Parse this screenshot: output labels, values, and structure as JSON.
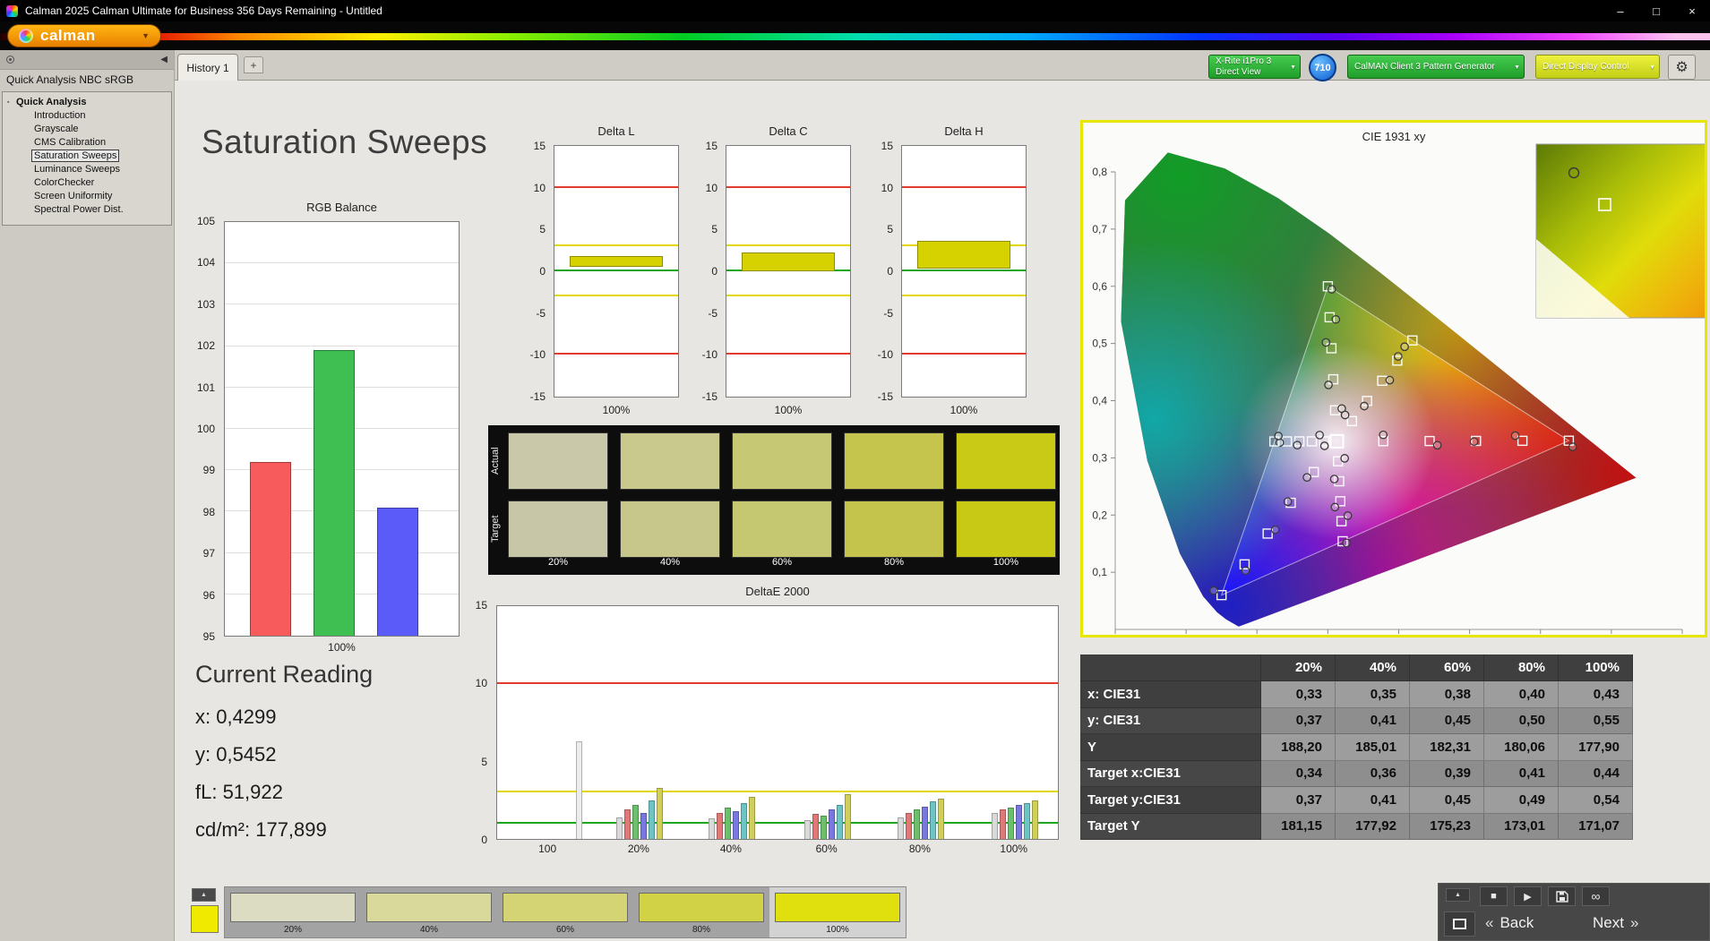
{
  "window": {
    "title": "Calman 2025 Calman Ultimate for Business 356 Days Remaining  - Untitled"
  },
  "icons": {
    "minimize": "–",
    "maximize": "□",
    "close": "×",
    "caret_down": "▼",
    "collapse_left": "◀",
    "up": "▲",
    "stop": "■",
    "play": "▶",
    "infinity": "∞",
    "gear": "⚙",
    "back_arrows": "«",
    "next_arrows": "»",
    "tree_bullet": "▪"
  },
  "toolbar": {
    "logo": "calman"
  },
  "tab_bar": {
    "tabs": [
      {
        "label": "History 1",
        "active": true
      }
    ],
    "add_label": "+",
    "meter_button": {
      "line1": "X-Rite i1Pro 3",
      "line2": "Direct View",
      "color": "#1f9e2a"
    },
    "meter_badge": "710",
    "source_button": {
      "line1": "CalMAN Client 3 Pattern Generator",
      "color": "#1f9e2a"
    },
    "display_button": {
      "line1": "Direct Display Control",
      "color": "#d8e02a"
    }
  },
  "sidebar": {
    "workflow_title": "Quick Analysis NBC sRGB",
    "root_item": "Quick Analysis",
    "items": [
      {
        "label": "Introduction",
        "selected": false
      },
      {
        "label": "Grayscale",
        "selected": false
      },
      {
        "label": "CMS Calibration",
        "selected": false
      },
      {
        "label": "Saturation Sweeps",
        "selected": true
      },
      {
        "label": "Luminance Sweeps",
        "selected": false
      },
      {
        "label": "ColorChecker",
        "selected": false
      },
      {
        "label": "Screen Uniformity",
        "selected": false
      },
      {
        "label": "Spectral Power Dist.",
        "selected": false
      }
    ]
  },
  "page_title": "Saturation Sweeps",
  "current_reading": {
    "title": "Current Reading",
    "x": "x: 0,4299",
    "y": "y: 0,5452",
    "fl": "fL: 51,922",
    "cdm2": "cd/m²: 177,899"
  },
  "chart_data": [
    {
      "id": "rgb_balance",
      "type": "bar",
      "title": "RGB Balance",
      "categories": [
        "Red",
        "Green",
        "Blue"
      ],
      "values": [
        99.2,
        101.9,
        98.1
      ],
      "colors": [
        "#f85b5b",
        "#3fbf51",
        "#5b5bf9"
      ],
      "ylim": [
        95,
        105
      ],
      "xlabel": "100%",
      "grid": true
    },
    {
      "id": "delta_l",
      "type": "bar",
      "title": "Delta L",
      "bar_from": 0.5,
      "bar_to": 1.8,
      "xlabel": "100%",
      "ylim": [
        -15,
        15
      ],
      "yticks": [
        -15,
        -10,
        -5,
        0,
        5,
        10,
        15
      ],
      "limit_lines": {
        "red": [
          10,
          -10
        ],
        "yellow": [
          3,
          -3
        ],
        "green": [
          0
        ]
      }
    },
    {
      "id": "delta_c",
      "type": "bar",
      "title": "Delta C",
      "bar_from": 0.0,
      "bar_to": 2.2,
      "xlabel": "100%",
      "ylim": [
        -15,
        15
      ],
      "yticks": [
        -15,
        -10,
        -5,
        0,
        5,
        10,
        15
      ],
      "limit_lines": {
        "red": [
          10,
          -10
        ],
        "yellow": [
          3,
          -3
        ],
        "green": [
          0
        ]
      }
    },
    {
      "id": "delta_h",
      "type": "bar",
      "title": "Delta H",
      "bar_from": 0.3,
      "bar_to": 3.6,
      "xlabel": "100%",
      "ylim": [
        -15,
        15
      ],
      "yticks": [
        -15,
        -10,
        -5,
        0,
        5,
        10,
        15
      ],
      "limit_lines": {
        "red": [
          10,
          -10
        ],
        "yellow": [
          3,
          -3
        ],
        "green": [
          0
        ]
      }
    },
    {
      "id": "deltae_2000",
      "type": "bar",
      "title": "DeltaE 2000",
      "ylim": [
        0,
        15
      ],
      "yticks": [
        0,
        5,
        10,
        15
      ],
      "limit_lines": {
        "red": 10,
        "yellow": 3,
        "green": 1
      },
      "bar_colors": [
        "#d9d9d9",
        "#e07878",
        "#6cc06c",
        "#7878e0",
        "#6cc4c4",
        "#cfcf5a"
      ],
      "groups": [
        {
          "label": "100",
          "x": 0.091,
          "bar_dx": 34,
          "values": [
            6.3
          ],
          "colors": [
            "#ececec"
          ]
        },
        {
          "label": "20%",
          "x": 0.253,
          "values": [
            1.4,
            1.9,
            2.2,
            1.7,
            2.5,
            3.3
          ]
        },
        {
          "label": "40%",
          "x": 0.417,
          "values": [
            1.3,
            1.7,
            2.0,
            1.8,
            2.3,
            2.7
          ]
        },
        {
          "label": "60%",
          "x": 0.587,
          "values": [
            1.2,
            1.6,
            1.5,
            1.9,
            2.2,
            2.9
          ]
        },
        {
          "label": "80%",
          "x": 0.753,
          "values": [
            1.4,
            1.7,
            1.9,
            2.1,
            2.4,
            2.6
          ]
        },
        {
          "label": "100%",
          "x": 0.92,
          "values": [
            1.7,
            1.9,
            2.0,
            2.2,
            2.3,
            2.5
          ]
        }
      ]
    },
    {
      "id": "cie_1931",
      "type": "scatter",
      "title": "CIE 1931 xy",
      "xlim": [
        0,
        0.8
      ],
      "ylim": [
        0,
        0.85
      ],
      "xticks": [
        "0",
        "0,1",
        "0,2",
        "0,3",
        "0,4",
        "0,5",
        "0,6",
        "0,7",
        "0,8"
      ],
      "yticks": [
        "0,1",
        "0,2",
        "0,3",
        "0,4",
        "0,5",
        "0,6",
        "0,7",
        "0,8"
      ],
      "white_point": [
        0.3127,
        0.329
      ],
      "saturation_steps": [
        0.2,
        0.4,
        0.6,
        0.8,
        1.0
      ],
      "hue_targets": {
        "red": [
          0.64,
          0.33
        ],
        "green": [
          0.3,
          0.6
        ],
        "blue": [
          0.15,
          0.06
        ],
        "cyan": [
          0.2246,
          0.3287
        ],
        "magenta": [
          0.3209,
          0.1542
        ],
        "yellow": [
          0.4193,
          0.5053
        ]
      }
    }
  ],
  "swatch_panel": {
    "row_labels": [
      "Actual",
      "Target"
    ],
    "col_labels": [
      "20%",
      "40%",
      "60%",
      "80%",
      "100%"
    ],
    "actual_colors": [
      "#c9c9a9",
      "#c9c98e",
      "#c7c873",
      "#c5c54e",
      "#c9ca16"
    ],
    "target_colors": [
      "#c7c7a7",
      "#c7c78c",
      "#c6c771",
      "#c4c44c",
      "#c8c914"
    ]
  },
  "results_table": {
    "columns": [
      "",
      "20%",
      "40%",
      "60%",
      "80%",
      "100%"
    ],
    "rows": [
      {
        "label": "x: CIE31",
        "values": [
          "0,33",
          "0,35",
          "0,38",
          "0,40",
          "0,43"
        ]
      },
      {
        "label": "y: CIE31",
        "values": [
          "0,37",
          "0,41",
          "0,45",
          "0,50",
          "0,55"
        ]
      },
      {
        "label": "Y",
        "values": [
          "188,20",
          "185,01",
          "182,31",
          "180,06",
          "177,90"
        ]
      },
      {
        "label": "Target x:CIE31",
        "values": [
          "0,34",
          "0,36",
          "0,39",
          "0,41",
          "0,44"
        ]
      },
      {
        "label": "Target y:CIE31",
        "values": [
          "0,37",
          "0,41",
          "0,45",
          "0,49",
          "0,54"
        ]
      },
      {
        "label": "Target Y",
        "values": [
          "181,15",
          "177,92",
          "175,23",
          "173,01",
          "171,07"
        ]
      }
    ]
  },
  "bottom_bar": {
    "current_patch_color": "#f0e900",
    "swatches": [
      {
        "label": "20%",
        "color": "#dcdcc3",
        "selected": false
      },
      {
        "label": "40%",
        "color": "#d9d99b",
        "selected": false
      },
      {
        "label": "60%",
        "color": "#d4d474",
        "selected": false
      },
      {
        "label": "80%",
        "color": "#d2d246",
        "selected": false
      },
      {
        "label": "100%",
        "color": "#e0e00e",
        "selected": true
      }
    ],
    "back_label": "Back",
    "next_label": "Next"
  }
}
